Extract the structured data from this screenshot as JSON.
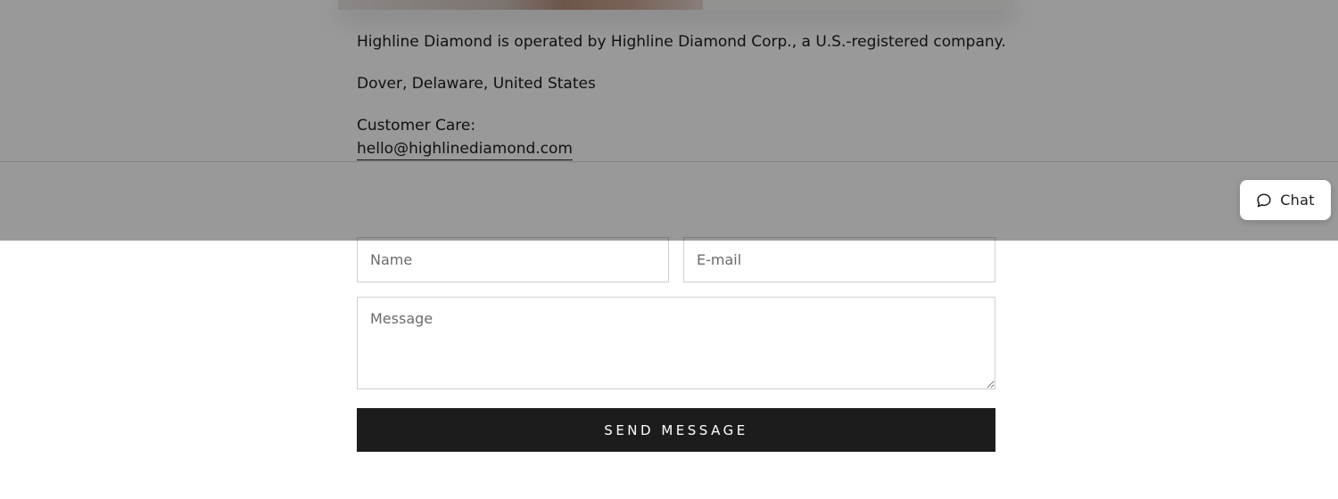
{
  "footer_info": {
    "company_statement": "Highline Diamond is operated by Highline Diamond Corp., a U.S.-registered company.",
    "address": "Dover, Delaware, United States",
    "customer_care_label": "Customer Care:",
    "email": "hello@highlinediamond.com"
  },
  "contact_form": {
    "name_placeholder": "Name",
    "email_placeholder": "E-mail",
    "message_placeholder": "Message",
    "send_label": "SEND MESSAGE"
  },
  "chat_widget": {
    "label": "Chat",
    "icon": "speech-bubble-icon"
  },
  "colors": {
    "button_background": "#1c1c1c",
    "text": "#1c1c1c",
    "overlay": "rgba(0,0,0,0.40)"
  }
}
